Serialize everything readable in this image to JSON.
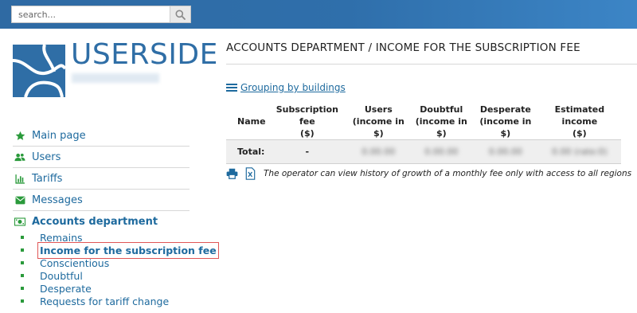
{
  "search": {
    "placeholder": "search..."
  },
  "logo": {
    "text": "USERSIDE"
  },
  "menu": [
    {
      "label": "Main page",
      "icon": "star-icon"
    },
    {
      "label": "Users",
      "icon": "users-icon"
    },
    {
      "label": "Tariffs",
      "icon": "bar-chart-icon"
    },
    {
      "label": "Messages",
      "icon": "envelope-icon"
    },
    {
      "label": "Accounts department",
      "icon": "money-icon"
    }
  ],
  "submenu": [
    {
      "label": "Remains"
    },
    {
      "label": "Income for the subscription fee"
    },
    {
      "label": "Conscientious"
    },
    {
      "label": "Doubtful"
    },
    {
      "label": "Desperate"
    },
    {
      "label": "Requests for tariff change"
    }
  ],
  "page": {
    "title": "ACCOUNTS DEPARTMENT / INCOME FOR THE SUBSCRIPTION FEE",
    "grouping_link": "Grouping by buildings"
  },
  "table": {
    "headers": [
      [
        "Name",
        ""
      ],
      [
        "Subscription fee",
        "($)"
      ],
      [
        "Users",
        "(income in $)"
      ],
      [
        "Doubtful",
        "(income in $)"
      ],
      [
        "Desperate",
        "(income in $)"
      ],
      [
        "Estimated income",
        "($)"
      ]
    ],
    "total_row": {
      "label": "Total:",
      "subscription_fee": "-",
      "users_income": "0.00.00",
      "doubtful_income": "0.00.00",
      "desperate_income": "0.00.00",
      "estimated_income": "0.00 (rate:0)"
    }
  },
  "note": "The operator can view history of growth of a monthly fee only with access to all regions",
  "colors": {
    "topbar": "#2f6fab",
    "link": "#1e6a9e",
    "icon_green": "#2a9a3b",
    "highlight": "#e05656"
  }
}
